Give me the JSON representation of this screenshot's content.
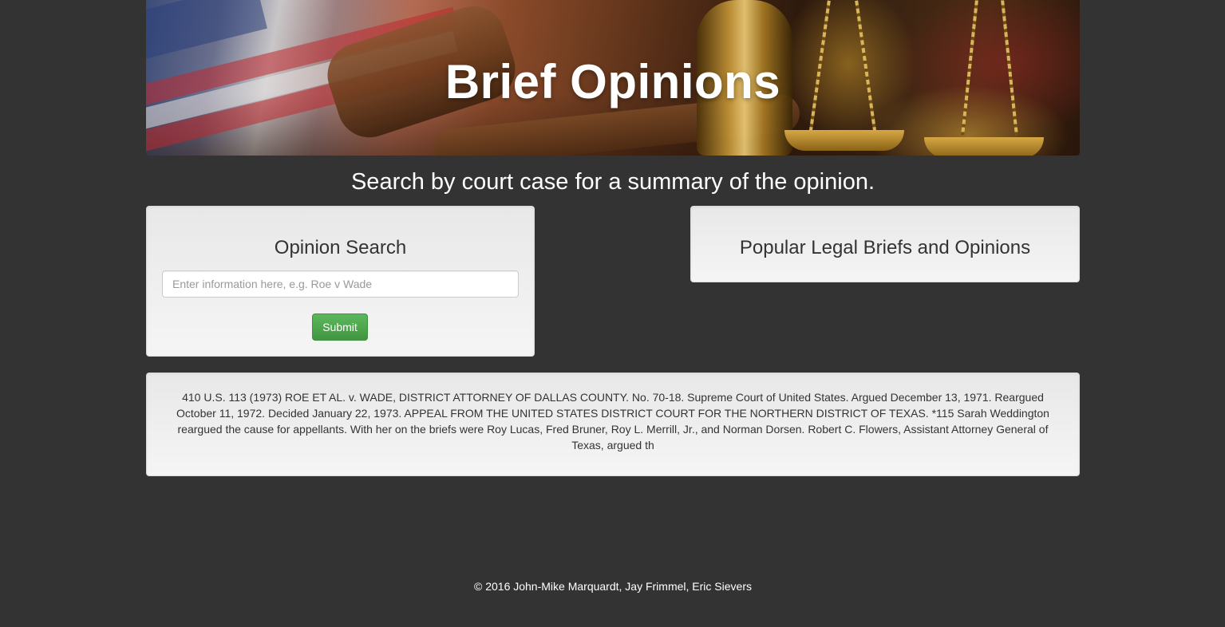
{
  "hero": {
    "title": "Brief Opinions"
  },
  "subtitle": "Search by court case for a summary of the opinion.",
  "search_panel": {
    "heading": "Opinion Search",
    "input_placeholder": "Enter information here, e.g. Roe v Wade",
    "input_value": "",
    "submit_label": "Submit"
  },
  "popular_panel": {
    "heading": "Popular Legal Briefs and Opinions"
  },
  "result_panel": {
    "text": "410 U.S. 113 (1973) ROE ET AL. v. WADE, DISTRICT ATTORNEY OF DALLAS COUNTY. No. 70-18. Supreme Court of United States. Argued December 13, 1971. Reargued October 11, 1972. Decided January 22, 1973. APPEAL FROM THE UNITED STATES DISTRICT COURT FOR THE NORTHERN DISTRICT OF TEXAS. *115 Sarah Weddington reargued the cause for appellants. With her on the briefs were Roy Lucas, Fred Bruner, Roy L. Merrill, Jr., and Norman Dorsen. Robert C. Flowers, Assistant Attorney General of Texas, argued th"
  },
  "footer": {
    "copyright": "© 2016 John-Mike Marquardt, Jay Frimmel, Eric Sievers"
  },
  "colors": {
    "page_background": "#333333",
    "submit_green": "#5cb85c",
    "panel_background": "#f5f5f5"
  }
}
